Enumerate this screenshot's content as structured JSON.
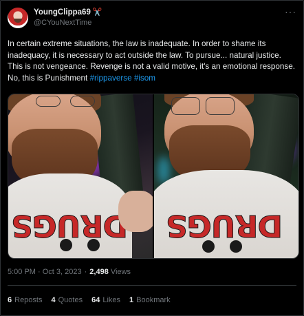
{
  "tweet": {
    "display_name": "YoungClippa69",
    "display_name_emoji": "✂️",
    "handle": "@CYouNextTime",
    "text_parts": {
      "body": "In certain extreme situations, the law is inadequate. In order to shame its inadequacy, it is necessary to act outside the law. To pursue... natural justice. This is not vengeance. Revenge is not a valid motive, it's an emotional response. No, this is Punishment ",
      "hashtag1": "#rippaverse",
      "hashtag2": "#isom"
    },
    "shirt_text": "DRUGS",
    "timestamp": "5:00 PM · Oct 3, 2023",
    "views_count": "2,498",
    "views_label": "Views",
    "stats": {
      "reposts_count": "6",
      "reposts_label": "Reposts",
      "quotes_count": "4",
      "quotes_label": "Quotes",
      "likes_count": "64",
      "likes_label": "Likes",
      "bookmarks_count": "1",
      "bookmarks_label": "Bookmark"
    }
  },
  "icons": {
    "more": "more-horizontal-icon",
    "scissors": "scissors-icon"
  },
  "colors": {
    "background": "#000000",
    "text": "#e7e9ea",
    "secondary": "#71767b",
    "link": "#1d9bf0",
    "border": "#2f3336"
  }
}
